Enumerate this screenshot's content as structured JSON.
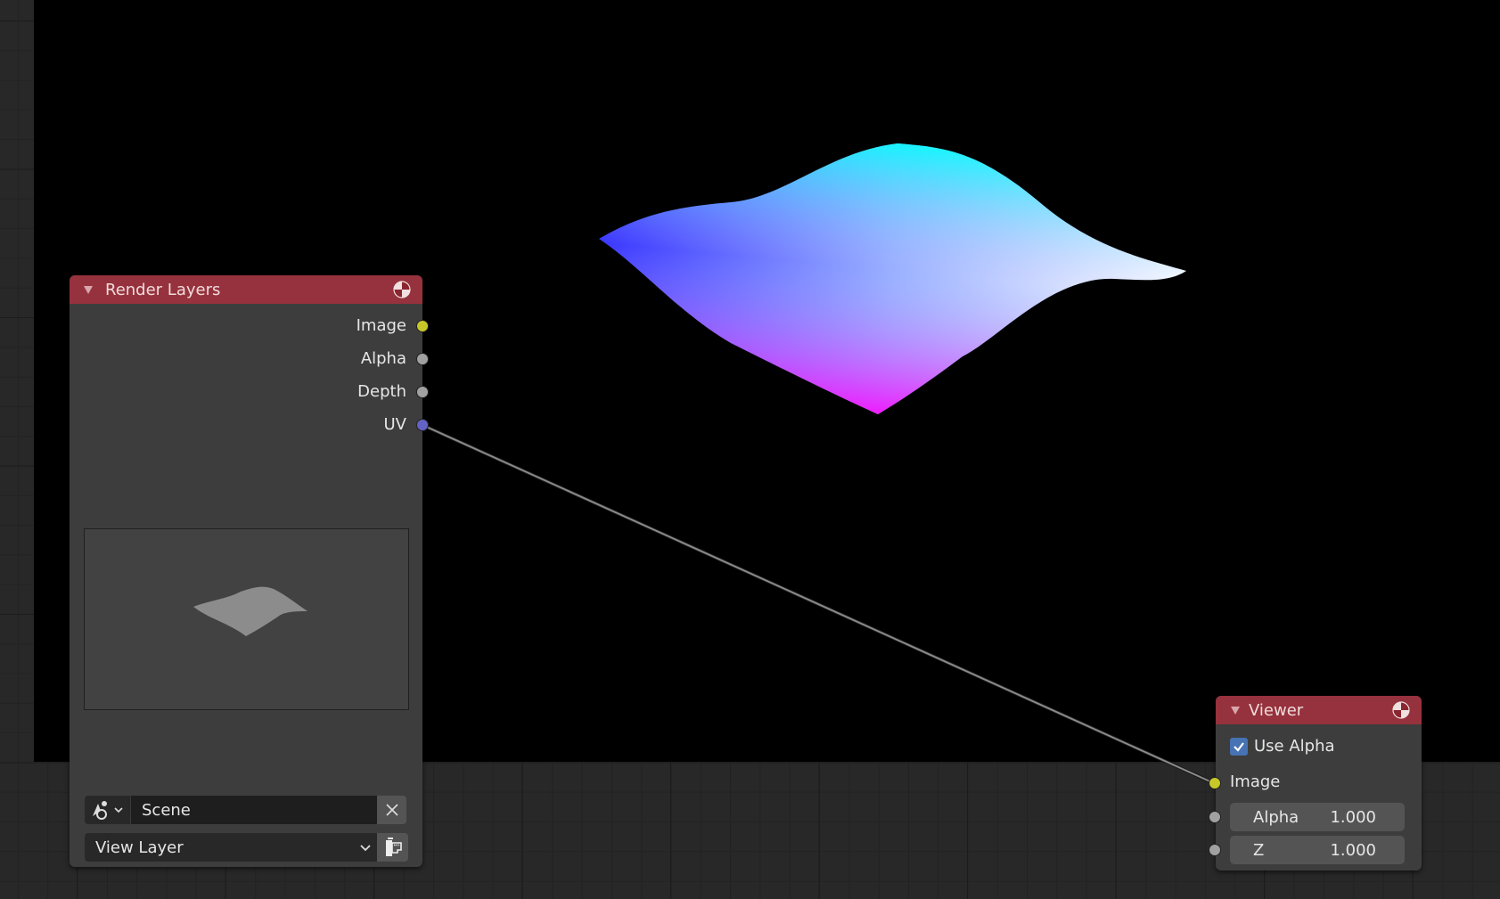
{
  "editor": "Compositor Node Editor",
  "backdrop": {
    "visible": true,
    "render": "uv-pass-surface"
  },
  "nodes": {
    "render_layers": {
      "title": "Render Layers",
      "header_color": "#96323d",
      "outputs": [
        {
          "label": "Image",
          "socket": "color",
          "color": "#c7c729"
        },
        {
          "label": "Alpha",
          "socket": "float",
          "color": "#a1a1a1"
        },
        {
          "label": "Depth",
          "socket": "float",
          "color": "#a1a1a1"
        },
        {
          "label": "UV",
          "socket": "vector",
          "color": "#6363c7"
        }
      ],
      "scene_field": {
        "value": "Scene",
        "clear_label": "×"
      },
      "view_layer_field": {
        "value": "View Layer"
      }
    },
    "viewer": {
      "title": "Viewer",
      "header_color": "#96323d",
      "use_alpha": {
        "label": "Use Alpha",
        "checked": true
      },
      "inputs": [
        {
          "label": "Image",
          "socket": "color",
          "color": "#c7c729"
        },
        {
          "label": "Alpha",
          "value": "1.000",
          "socket": "float",
          "color": "#a1a1a1"
        },
        {
          "label": "Z",
          "value": "1.000",
          "socket": "float",
          "color": "#a1a1a1"
        }
      ]
    }
  },
  "links": [
    {
      "from": "Render Layers.UV",
      "to": "Viewer.Image"
    }
  ]
}
